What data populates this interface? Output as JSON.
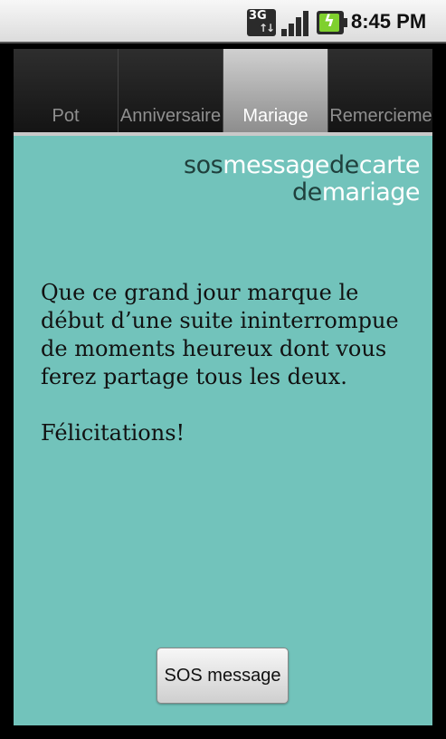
{
  "status_bar": {
    "network_label": "3G",
    "network_icon": "3g-data-icon",
    "signal_icon": "signal-strength-icon",
    "battery_icon": "battery-charging-icon",
    "time": "8:45 PM"
  },
  "tabs": [
    {
      "label": "Pot",
      "active": false
    },
    {
      "label": "Anniversaire",
      "active": false
    },
    {
      "label": "Mariage",
      "active": true
    },
    {
      "label": "Remercieme",
      "active": false
    }
  ],
  "brand": {
    "line1": [
      {
        "text": "sos",
        "tone": "dark"
      },
      {
        "text": "message",
        "tone": "light"
      },
      {
        "text": "de",
        "tone": "dark"
      },
      {
        "text": "carte",
        "tone": "light"
      }
    ],
    "line2": [
      {
        "text": "de",
        "tone": "dark"
      },
      {
        "text": "mariage",
        "tone": "light"
      }
    ]
  },
  "message": "Que ce grand jour marque le début d’une suite ininterrompue de moments heureux dont vous ferez partage tous les deux.\n\nFélicitations!",
  "button": {
    "label": "SOS message"
  },
  "colors": {
    "content_background": "#72c3bb",
    "brand_dark": "#1f3f3c",
    "brand_light": "#ffffff",
    "active_tab": "#b0b0b0"
  }
}
